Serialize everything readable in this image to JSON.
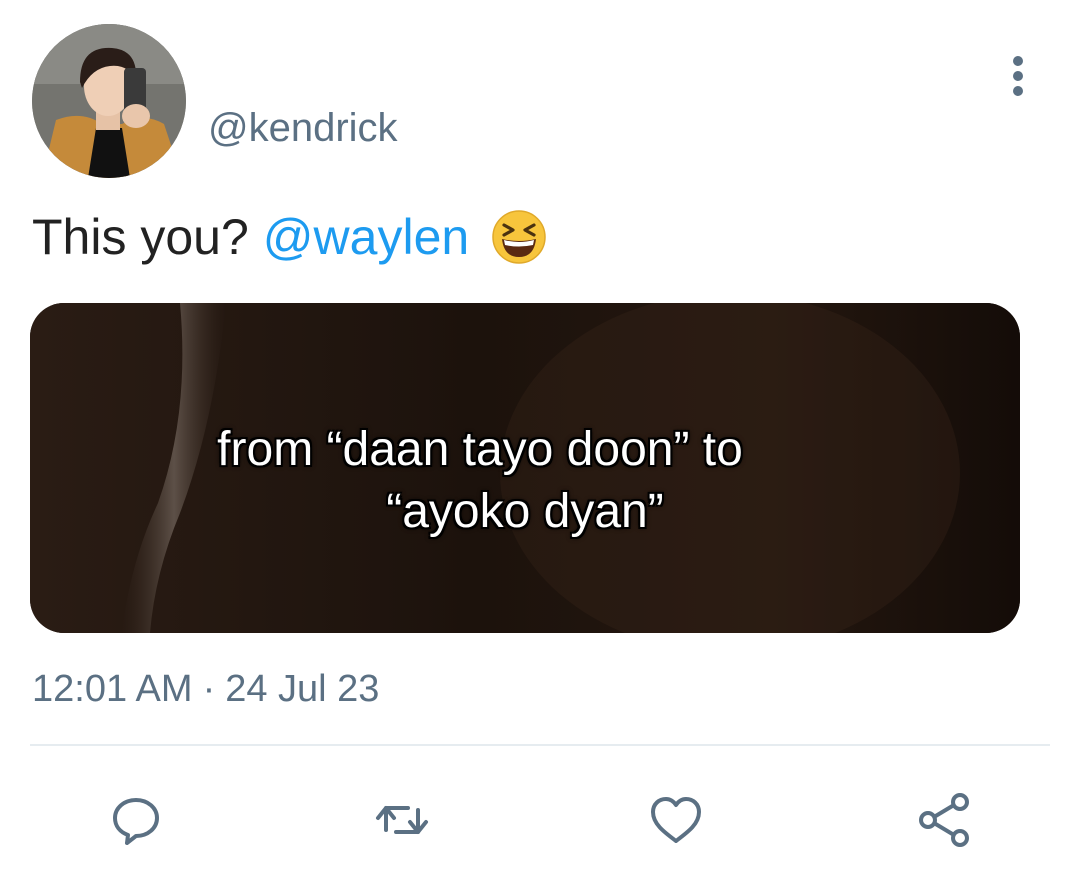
{
  "tweet": {
    "handle": "@kendrick",
    "text": "This you?",
    "mention": "@waylen",
    "emoji_icon": "grinning-squinting-face-icon",
    "media": {
      "caption_line1": "from “daan tayo doon” to",
      "caption_line2": "“ayoko dyan”"
    },
    "time": "12:01 AM",
    "separator": "·",
    "date": "24 Jul 23"
  },
  "actions": [
    {
      "name": "reply",
      "icon": "reply-bubble-icon"
    },
    {
      "name": "retweet",
      "icon": "retweet-icon"
    },
    {
      "name": "like",
      "icon": "heart-icon"
    },
    {
      "name": "share",
      "icon": "share-icon"
    }
  ],
  "colors": {
    "accent": "#1d9bf0",
    "muted": "#5b7083",
    "divider": "#e6ecf0"
  }
}
